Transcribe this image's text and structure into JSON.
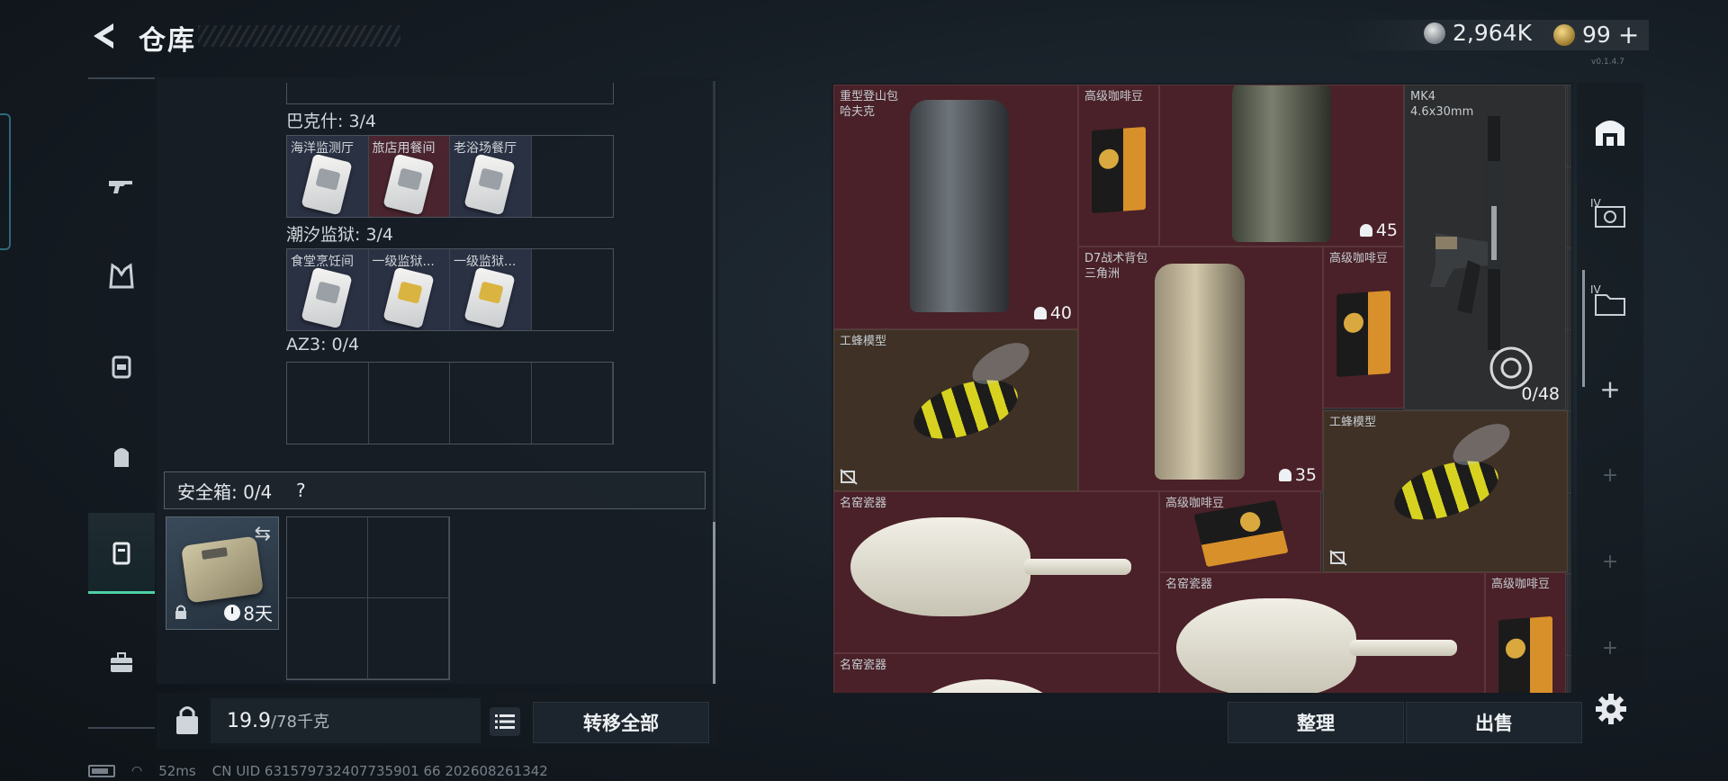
{
  "header": {
    "title": "仓库",
    "currency_silver": "2,964K",
    "currency_gold": "99",
    "gold_plus": "+",
    "version": "v0.1.4.7"
  },
  "left_rail": [
    "weapon",
    "armor",
    "vest",
    "backpack",
    "safe-box",
    "toolbox"
  ],
  "containers": [
    {
      "label": "巴克什: 3/4",
      "cells": [
        {
          "name": "海洋监测厅",
          "style": "blue",
          "card": "gray"
        },
        {
          "name": "旅店用餐间",
          "style": "red",
          "card": "gray"
        },
        {
          "name": "老浴场餐厅",
          "style": "blue",
          "card": "gray"
        },
        {
          "name": "",
          "style": "empty",
          "card": ""
        }
      ]
    },
    {
      "label": "潮汐监狱: 3/4",
      "cells": [
        {
          "name": "食堂烹饪间",
          "style": "blue",
          "card": "gray"
        },
        {
          "name": "一级监狱...",
          "style": "blue",
          "card": "gold"
        },
        {
          "name": "一级监狱...",
          "style": "blue",
          "card": "gold"
        },
        {
          "name": "",
          "style": "empty",
          "card": ""
        }
      ]
    },
    {
      "label": "AZ3: 0/4"
    }
  ],
  "safe_box": {
    "title": "安全箱: 0/4",
    "help": "?",
    "timer": "8天"
  },
  "weight": {
    "current": "19.9",
    "max": "/78千克"
  },
  "buttons": {
    "transfer_all": "转移全部",
    "sort": "整理",
    "sell": "出售"
  },
  "status": {
    "ping": "52ms",
    "uid": "CN UID 631579732407735901 66 202608261342"
  },
  "inventory": {
    "heavy_backpack_name": "重型登山包",
    "heavy_backpack_sub": "哈夫克",
    "heavy_backpack_count": "40",
    "coffee_name": "高级咖啡豆",
    "backpack2_count": "45",
    "gun_name": "MK4",
    "gun_sub": "4.6x30mm",
    "gun_ammo": "0/48",
    "d7_name": "D7战术背包",
    "d7_sub": "三角洲",
    "d7_count": "35",
    "bee_name": "工蜂模型",
    "vase_name": "名窑瓷器"
  },
  "colors": {
    "accent": "#4dd0a4",
    "item_red": "#4a2128",
    "item_brown": "#3f3126"
  }
}
